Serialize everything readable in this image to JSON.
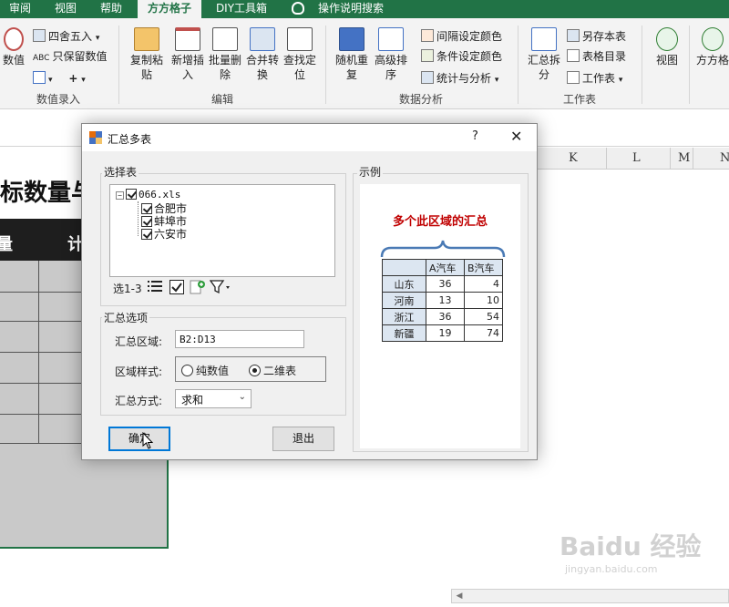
{
  "ribbon": {
    "tabs": [
      "审阅",
      "视图",
      "帮助",
      "方方格子",
      "DIY工具箱",
      "操作说明搜索"
    ],
    "active_tab": "方方格子",
    "groups": {
      "number_entry": {
        "label": "数值录入",
        "big_button": "数值",
        "items": [
          "四舍五入",
          "只保留数值"
        ]
      },
      "edit": {
        "label": "编辑",
        "buttons": [
          "复制粘贴",
          "新增插入",
          "批量删除",
          "合并转换",
          "查找定位"
        ]
      },
      "analysis": {
        "label": "数据分析",
        "buttons": [
          "随机重复",
          "高级排序"
        ],
        "items": [
          "间隔设定颜色",
          "条件设定颜色",
          "统计与分析"
        ]
      },
      "worksheet": {
        "label": "工作表",
        "big_button": "汇总拆分",
        "items": [
          "另存本表",
          "表格目录",
          "工作表"
        ]
      },
      "view_button": "视图",
      "last_button": "方方格子"
    }
  },
  "columns": [
    "K",
    "L",
    "M",
    "N"
  ],
  "sheet": {
    "banner_text": "标数量与",
    "header_left": "量",
    "header_right": "计"
  },
  "dialog": {
    "title": "汇总多表",
    "help": "?",
    "close": "✕",
    "select_section": "选择表",
    "tree": {
      "root": "066.xls",
      "children": [
        "合肥市",
        "蚌埠市",
        "六安市"
      ]
    },
    "selection_count": "选1-3",
    "options_section": "汇总选项",
    "range_label": "汇总区域:",
    "range_value": "B2:D13",
    "style_label": "区域样式:",
    "style_options": [
      "纯数值",
      "二维表"
    ],
    "style_selected": "二维表",
    "method_label": "汇总方式:",
    "method_value": "求和",
    "ok_button": "确定",
    "exit_button": "退出",
    "example_section": "示例",
    "example": {
      "caption": "多个此区域的汇总",
      "headers": [
        "",
        "A汽车",
        "B汽车"
      ],
      "rows": [
        {
          "name": "山东",
          "a": "36",
          "b": "4"
        },
        {
          "name": "河南",
          "a": "13",
          "b": "10"
        },
        {
          "name": "浙江",
          "a": "36",
          "b": "54"
        },
        {
          "name": "新疆",
          "a": "19",
          "b": "74"
        }
      ]
    }
  },
  "watermark": {
    "brand": "Baidu 经验",
    "url": "jingyan.baidu.com"
  },
  "colors": {
    "excel_green": "#217346",
    "accent_blue": "#0078d7",
    "example_red": "#c00000"
  }
}
